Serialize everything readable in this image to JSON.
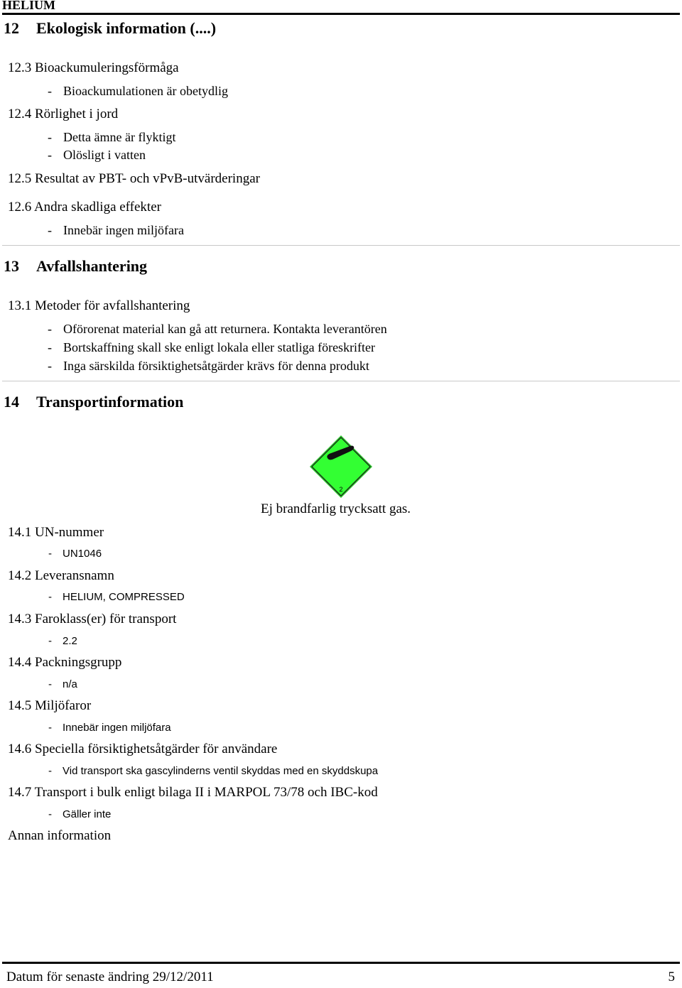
{
  "header": {
    "title": "HELIUM"
  },
  "section12": {
    "number": "12",
    "title": "Ekologisk information (....)",
    "s12_3": {
      "label": "12.3 Bioackumuleringsförmåga",
      "items": [
        "Bioackumulationen är obetydlig"
      ]
    },
    "s12_4": {
      "label": "12.4 Rörlighet i jord",
      "items": [
        "Detta ämne är flyktigt",
        "Olösligt i vatten"
      ]
    },
    "s12_5": {
      "label": "12.5 Resultat av PBT- och vPvB-utvärderingar"
    },
    "s12_6": {
      "label": "12.6 Andra skadliga effekter",
      "items": [
        "Innebär ingen miljöfara"
      ]
    }
  },
  "section13": {
    "number": "13",
    "title": "Avfallshantering",
    "s13_1": {
      "label": "13.1 Metoder för avfallshantering",
      "items": [
        "Oförorenat material kan gå att returnera. Kontakta leverantören",
        "Bortskaffning skall ske enligt lokala eller statliga föreskrifter",
        "Inga särskilda försiktighetsåtgärder krävs för denna produkt"
      ]
    }
  },
  "section14": {
    "number": "14",
    "title": "Transportinformation",
    "hazard_label": {
      "icon": "gas-cylinder-hazard-icon",
      "class_number": "2",
      "color": "#33ff33",
      "caption": "Ej brandfarlig trycksatt gas."
    },
    "s14_1": {
      "label": "14.1 UN-nummer",
      "items": [
        "UN1046"
      ]
    },
    "s14_2": {
      "label": "14.2 Leveransnamn",
      "items": [
        "HELIUM, COMPRESSED"
      ]
    },
    "s14_3": {
      "label": "14.3 Faroklass(er) för transport",
      "items": [
        "2.2"
      ]
    },
    "s14_4": {
      "label": "14.4 Packningsgrupp",
      "items": [
        "n/a"
      ]
    },
    "s14_5": {
      "label": "14.5 Miljöfaror",
      "items": [
        "Innebär ingen miljöfara"
      ]
    },
    "s14_6": {
      "label": "14.6 Speciella försiktighetsåtgärder för användare",
      "items": [
        "Vid transport ska gascylinderns ventil skyddas med en skyddskupa"
      ]
    },
    "s14_7": {
      "label": "14.7 Transport i bulk enligt bilaga II i MARPOL 73/78 och IBC-kod",
      "items": [
        "Gäller inte"
      ]
    }
  },
  "other": {
    "label": "Annan information"
  },
  "footer": {
    "revision": "Datum för senaste ändring 29/12/2011",
    "page_number": "5"
  },
  "bullet_dash": "-"
}
